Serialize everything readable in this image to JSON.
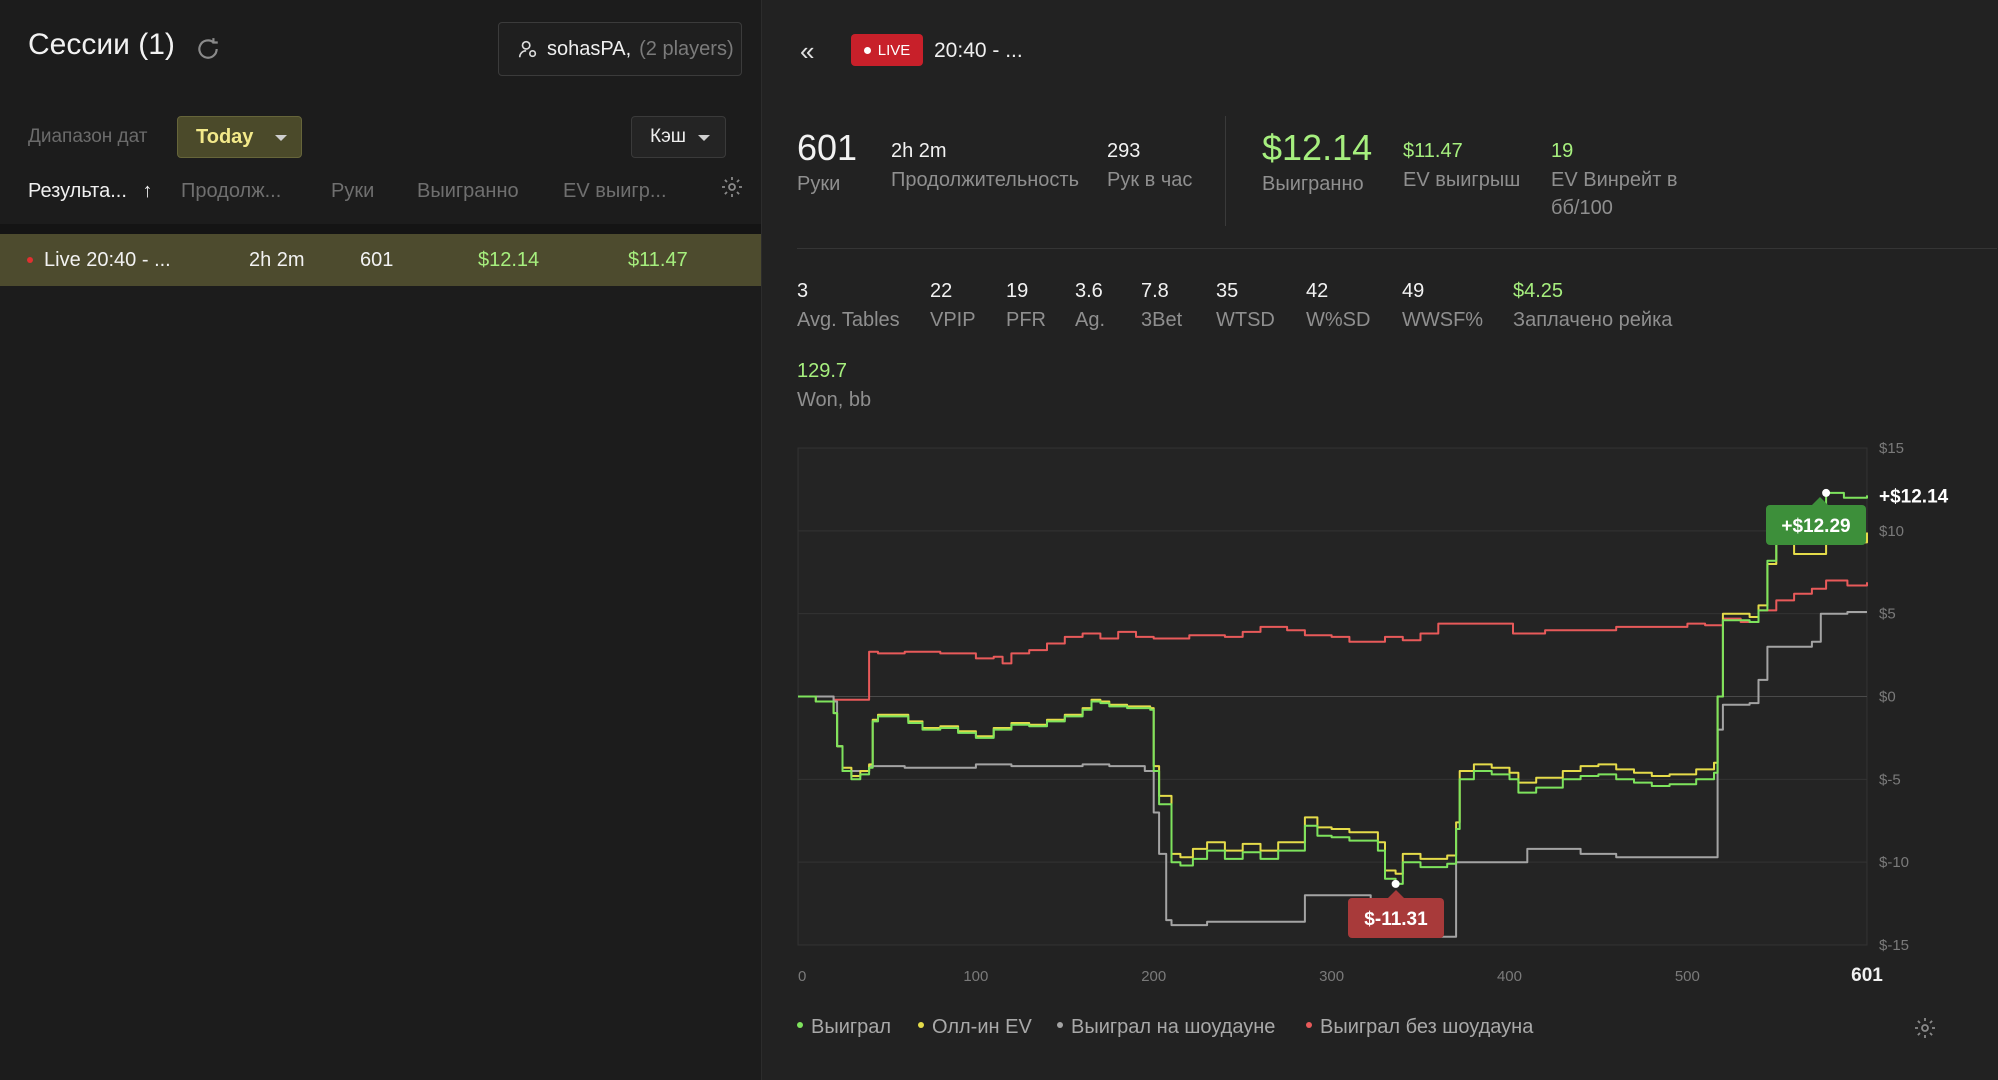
{
  "left": {
    "title": "Сессии (1)",
    "player": {
      "name": "sohasPA",
      "count": "(2 players)"
    },
    "date_range_label": "Диапазон дат",
    "date_range_value": "Today",
    "game_type": "Кэш",
    "columns": [
      "Результа...",
      "Продолж...",
      "Руки",
      "Выигранно",
      "EV выигр..."
    ],
    "sort_arrow": "↑",
    "rows": [
      {
        "name": "Live 20:40 - ...",
        "duration": "2h 2m",
        "hands": "601",
        "won": "$12.14",
        "ev_won": "$11.47"
      }
    ]
  },
  "header": {
    "back": "«",
    "live_badge": "LIVE",
    "session_name": "20:40 - ..."
  },
  "stats_top": [
    {
      "value": "601",
      "label": "Руки"
    },
    {
      "value": "2h 2m",
      "label": "Продолжительность"
    },
    {
      "value": "293",
      "label": "Рук в час"
    },
    {
      "value": "$12.14",
      "label": "Выигранно"
    },
    {
      "value": "$11.47",
      "label": "EV выигрыш"
    },
    {
      "value": "19",
      "label": "EV Винрейт в бб/100"
    }
  ],
  "stats_bottom": [
    {
      "value": "3",
      "label": "Avg. Tables"
    },
    {
      "value": "22",
      "label": "VPIP"
    },
    {
      "value": "19",
      "label": "PFR"
    },
    {
      "value": "3.6",
      "label": "Ag."
    },
    {
      "value": "7.8",
      "label": "3Bet"
    },
    {
      "value": "35",
      "label": "WTSD"
    },
    {
      "value": "42",
      "label": "W%SD"
    },
    {
      "value": "49",
      "label": "WWSF%"
    },
    {
      "value": "$4.25",
      "label": "Заплачено рейка"
    }
  ],
  "stat_won_bb": {
    "value": "129.7",
    "label": "Won, bb"
  },
  "chart_data": {
    "type": "line",
    "x_ticks": [
      "0",
      "100",
      "200",
      "300",
      "400",
      "500",
      "601"
    ],
    "y_ticks": [
      "$15",
      "$10",
      "$5",
      "$0",
      "$-5",
      "$-10",
      "$-15"
    ],
    "xlim": [
      0,
      601
    ],
    "ylim": [
      -15,
      15
    ],
    "end_label": "+$12.14",
    "max_label": "+$12.29",
    "min_label": "$-11.31",
    "max_point": {
      "x": 578,
      "y": 12.29
    },
    "min_point": {
      "x": 336,
      "y": -11.31
    },
    "series": [
      {
        "name": "Выиграл",
        "color": "#7ee35d",
        "points": [
          [
            0,
            0
          ],
          [
            10,
            -0.3
          ],
          [
            20,
            -1
          ],
          [
            22,
            -3
          ],
          [
            25,
            -4.5
          ],
          [
            30,
            -5
          ],
          [
            35,
            -4.7
          ],
          [
            40,
            -4.3
          ],
          [
            42,
            -1.5
          ],
          [
            45,
            -1.2
          ],
          [
            55,
            -1.2
          ],
          [
            62,
            -1.6
          ],
          [
            70,
            -2
          ],
          [
            80,
            -1.9
          ],
          [
            90,
            -2.2
          ],
          [
            100,
            -2.5
          ],
          [
            110,
            -2
          ],
          [
            120,
            -1.7
          ],
          [
            130,
            -1.8
          ],
          [
            140,
            -1.5
          ],
          [
            150,
            -1.2
          ],
          [
            160,
            -0.8
          ],
          [
            165,
            -0.3
          ],
          [
            170,
            -0.4
          ],
          [
            175,
            -0.6
          ],
          [
            185,
            -0.7
          ],
          [
            198,
            -0.8
          ],
          [
            200,
            -4.5
          ],
          [
            203,
            -6.5
          ],
          [
            210,
            -10
          ],
          [
            215,
            -10.2
          ],
          [
            222,
            -9.8
          ],
          [
            230,
            -9.3
          ],
          [
            240,
            -9.8
          ],
          [
            250,
            -9.4
          ],
          [
            260,
            -9.8
          ],
          [
            270,
            -9.3
          ],
          [
            285,
            -7.8
          ],
          [
            292,
            -8.4
          ],
          [
            300,
            -8.5
          ],
          [
            310,
            -8.7
          ],
          [
            320,
            -8.7
          ],
          [
            326,
            -9.3
          ],
          [
            330,
            -11
          ],
          [
            336,
            -11.31
          ],
          [
            340,
            -10
          ],
          [
            350,
            -10.3
          ],
          [
            365,
            -10.1
          ],
          [
            370,
            -8
          ],
          [
            372,
            -5
          ],
          [
            380,
            -4.5
          ],
          [
            390,
            -4.7
          ],
          [
            400,
            -5
          ],
          [
            405,
            -5.8
          ],
          [
            415,
            -5.5
          ],
          [
            430,
            -5
          ],
          [
            440,
            -4.8
          ],
          [
            450,
            -4.7
          ],
          [
            460,
            -5
          ],
          [
            470,
            -5.2
          ],
          [
            480,
            -5.4
          ],
          [
            490,
            -5.3
          ],
          [
            505,
            -5
          ],
          [
            515,
            -4.6
          ],
          [
            517,
            0
          ],
          [
            520,
            4.6
          ],
          [
            535,
            4.5
          ],
          [
            540,
            5.2
          ],
          [
            545,
            8.2
          ],
          [
            550,
            9.5
          ],
          [
            560,
            9.3
          ],
          [
            578,
            12.29
          ],
          [
            588,
            12
          ],
          [
            601,
            12.14
          ]
        ]
      },
      {
        "name": "Олл-ин EV",
        "color": "#e5dc4a",
        "points": [
          [
            0,
            0
          ],
          [
            10,
            -0.3
          ],
          [
            20,
            -1
          ],
          [
            22,
            -3
          ],
          [
            25,
            -4.3
          ],
          [
            30,
            -4.8
          ],
          [
            35,
            -4.5
          ],
          [
            40,
            -4.1
          ],
          [
            42,
            -1.4
          ],
          [
            45,
            -1.1
          ],
          [
            55,
            -1.1
          ],
          [
            62,
            -1.5
          ],
          [
            70,
            -1.9
          ],
          [
            80,
            -1.8
          ],
          [
            90,
            -2.1
          ],
          [
            100,
            -2.4
          ],
          [
            110,
            -1.9
          ],
          [
            120,
            -1.6
          ],
          [
            130,
            -1.7
          ],
          [
            140,
            -1.4
          ],
          [
            150,
            -1.1
          ],
          [
            160,
            -0.7
          ],
          [
            165,
            -0.2
          ],
          [
            170,
            -0.3
          ],
          [
            175,
            -0.5
          ],
          [
            185,
            -0.6
          ],
          [
            198,
            -0.7
          ],
          [
            200,
            -4.2
          ],
          [
            203,
            -6
          ],
          [
            210,
            -9.5
          ],
          [
            215,
            -9.7
          ],
          [
            222,
            -9.2
          ],
          [
            230,
            -8.8
          ],
          [
            240,
            -9.3
          ],
          [
            250,
            -8.9
          ],
          [
            260,
            -9.3
          ],
          [
            270,
            -8.8
          ],
          [
            285,
            -7.3
          ],
          [
            292,
            -7.9
          ],
          [
            300,
            -8
          ],
          [
            310,
            -8.2
          ],
          [
            320,
            -8.2
          ],
          [
            326,
            -8.8
          ],
          [
            330,
            -10.5
          ],
          [
            336,
            -10.7
          ],
          [
            340,
            -9.5
          ],
          [
            350,
            -9.8
          ],
          [
            365,
            -9.6
          ],
          [
            370,
            -7.6
          ],
          [
            372,
            -4.5
          ],
          [
            380,
            -4.1
          ],
          [
            390,
            -4.3
          ],
          [
            400,
            -4.6
          ],
          [
            405,
            -5.2
          ],
          [
            415,
            -4.9
          ],
          [
            430,
            -4.5
          ],
          [
            440,
            -4.2
          ],
          [
            450,
            -4.1
          ],
          [
            460,
            -4.4
          ],
          [
            470,
            -4.6
          ],
          [
            480,
            -4.8
          ],
          [
            490,
            -4.7
          ],
          [
            505,
            -4.4
          ],
          [
            515,
            -4
          ],
          [
            517,
            0
          ],
          [
            520,
            5
          ],
          [
            535,
            4.8
          ],
          [
            540,
            5.5
          ],
          [
            545,
            8
          ],
          [
            550,
            9.3
          ],
          [
            560,
            8.6
          ],
          [
            578,
            9.8
          ],
          [
            590,
            9.3
          ],
          [
            601,
            9.9
          ]
        ]
      },
      {
        "name": "Выиграл на шоудауне",
        "color": "#a4a4a4",
        "points": [
          [
            0,
            0
          ],
          [
            20,
            -0.3
          ],
          [
            22,
            -3
          ],
          [
            25,
            -4.5
          ],
          [
            30,
            -4.5
          ],
          [
            40,
            -4.2
          ],
          [
            60,
            -4.3
          ],
          [
            80,
            -4.3
          ],
          [
            100,
            -4.1
          ],
          [
            120,
            -4.2
          ],
          [
            140,
            -4.2
          ],
          [
            160,
            -4.1
          ],
          [
            175,
            -4.2
          ],
          [
            195,
            -4.5
          ],
          [
            198,
            -4.5
          ],
          [
            200,
            -7
          ],
          [
            203,
            -9.5
          ],
          [
            207,
            -13.5
          ],
          [
            210,
            -13.8
          ],
          [
            230,
            -13.6
          ],
          [
            250,
            -13.6
          ],
          [
            270,
            -13.6
          ],
          [
            285,
            -12
          ],
          [
            300,
            -12
          ],
          [
            315,
            -12
          ],
          [
            322,
            -12.8
          ],
          [
            330,
            -14.2
          ],
          [
            336,
            -14.5
          ],
          [
            345,
            -14.5
          ],
          [
            365,
            -14.5
          ],
          [
            370,
            -10
          ],
          [
            380,
            -10
          ],
          [
            400,
            -10
          ],
          [
            410,
            -9.2
          ],
          [
            420,
            -9.2
          ],
          [
            440,
            -9.5
          ],
          [
            460,
            -9.7
          ],
          [
            480,
            -9.7
          ],
          [
            500,
            -9.7
          ],
          [
            514,
            -9.7
          ],
          [
            517,
            -2
          ],
          [
            520,
            -0.5
          ],
          [
            535,
            -0.4
          ],
          [
            540,
            1
          ],
          [
            545,
            3
          ],
          [
            555,
            3
          ],
          [
            570,
            3.3
          ],
          [
            575,
            5
          ],
          [
            590,
            5.1
          ],
          [
            601,
            5.1
          ]
        ]
      },
      {
        "name": "Выиграл без шоудауна",
        "color": "#e85a5a",
        "points": [
          [
            0,
            0
          ],
          [
            10,
            0
          ],
          [
            20,
            -0.2
          ],
          [
            35,
            -0.2
          ],
          [
            40,
            2.7
          ],
          [
            45,
            2.6
          ],
          [
            60,
            2.7
          ],
          [
            80,
            2.6
          ],
          [
            100,
            2.3
          ],
          [
            110,
            2.4
          ],
          [
            115,
            2
          ],
          [
            120,
            2.6
          ],
          [
            130,
            2.8
          ],
          [
            140,
            3.2
          ],
          [
            150,
            3.6
          ],
          [
            160,
            3.8
          ],
          [
            170,
            3.5
          ],
          [
            180,
            3.9
          ],
          [
            190,
            3.6
          ],
          [
            200,
            3.5
          ],
          [
            220,
            3.7
          ],
          [
            240,
            3.6
          ],
          [
            250,
            3.9
          ],
          [
            260,
            4.2
          ],
          [
            275,
            4
          ],
          [
            285,
            3.7
          ],
          [
            300,
            3.6
          ],
          [
            310,
            3.3
          ],
          [
            330,
            3.6
          ],
          [
            340,
            3.4
          ],
          [
            350,
            3.8
          ],
          [
            360,
            4.4
          ],
          [
            380,
            4.4
          ],
          [
            400,
            4.4
          ],
          [
            402,
            3.8
          ],
          [
            420,
            4
          ],
          [
            440,
            4
          ],
          [
            460,
            4.2
          ],
          [
            480,
            4.2
          ],
          [
            500,
            4.4
          ],
          [
            510,
            4.3
          ],
          [
            520,
            4.7
          ],
          [
            530,
            4.5
          ],
          [
            540,
            5.2
          ],
          [
            550,
            5.8
          ],
          [
            560,
            6.2
          ],
          [
            570,
            6.5
          ],
          [
            578,
            7
          ],
          [
            590,
            6.7
          ],
          [
            601,
            6.9
          ]
        ]
      }
    ]
  },
  "legend": [
    "Выиграл",
    "Олл-ин EV",
    "Выиграл на шоудауне",
    "Выиграл без шоудауна"
  ],
  "colors": {
    "accent_yellow": "#f3e98a",
    "positive": "#a6ef7e",
    "live": "#c8202a",
    "row_highlight": "#4d4b2e"
  }
}
